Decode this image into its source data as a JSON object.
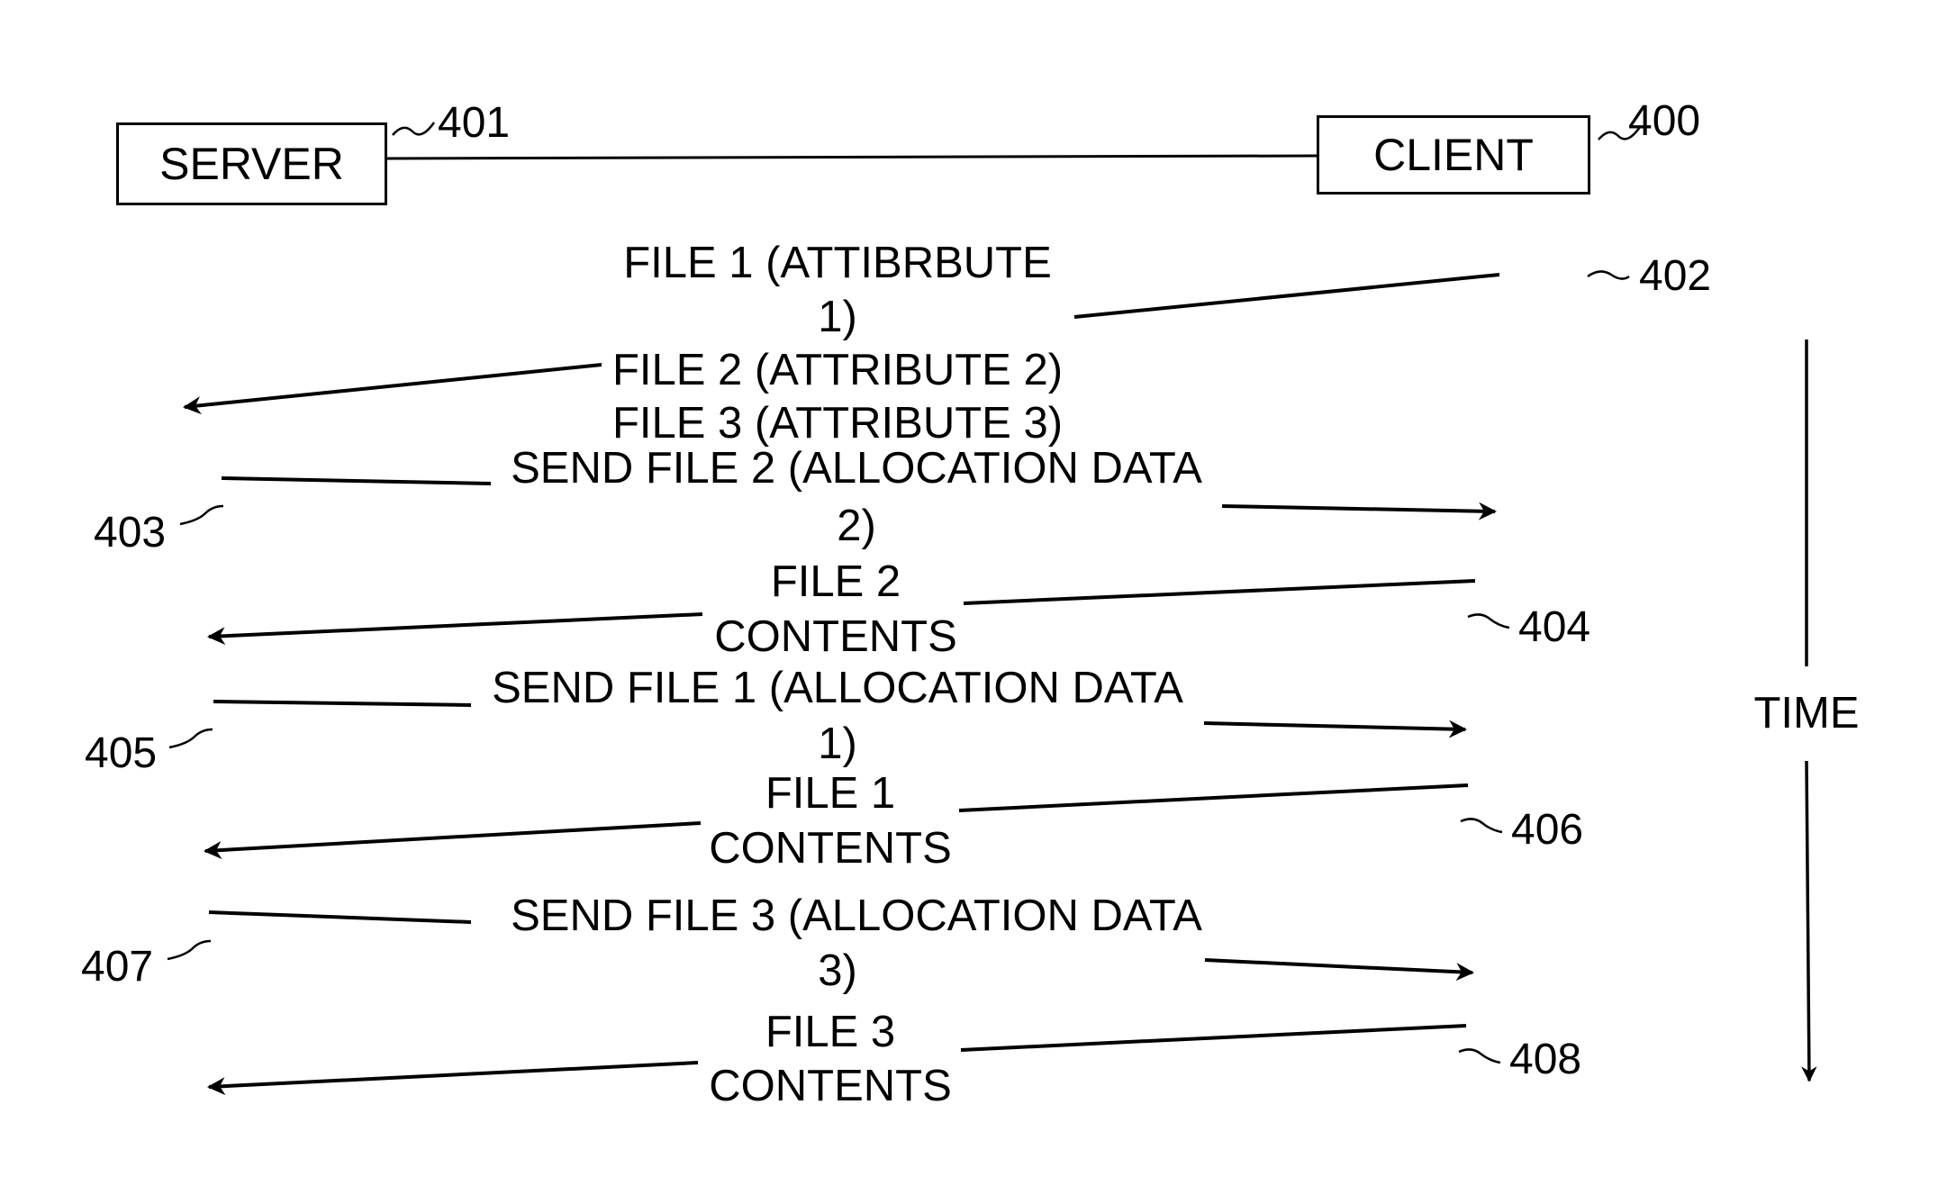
{
  "figure": {
    "entities": {
      "server": {
        "label": "SERVER",
        "ref": "401"
      },
      "client": {
        "label": "CLIENT",
        "ref": "400"
      }
    },
    "time_axis": {
      "label": "TIME",
      "direction": "down"
    },
    "messages": [
      {
        "ref": "402",
        "from": "client",
        "to": "server",
        "lines": [
          "FILE 1 (ATTIBRBUTE",
          "1)",
          "FILE 2 (ATTRIBUTE 2)",
          "FILE 3 (ATTRIBUTE 3)"
        ]
      },
      {
        "ref": "403",
        "from": "server",
        "to": "client",
        "lines": [
          "SEND FILE 2 (ALLOCATION DATA",
          "2)"
        ]
      },
      {
        "ref": "404",
        "from": "client",
        "to": "server",
        "lines": [
          "FILE 2",
          "CONTENTS"
        ]
      },
      {
        "ref": "405",
        "from": "server",
        "to": "client",
        "lines": [
          "SEND FILE 1 (ALLOCATION DATA",
          "1)"
        ]
      },
      {
        "ref": "406",
        "from": "client",
        "to": "server",
        "lines": [
          "FILE 1",
          "CONTENTS"
        ]
      },
      {
        "ref": "407",
        "from": "server",
        "to": "client",
        "lines": [
          "SEND FILE 3 (ALLOCATION DATA",
          "3)"
        ]
      },
      {
        "ref": "408",
        "from": "client",
        "to": "server",
        "lines": [
          "FILE 3",
          "CONTENTS"
        ]
      }
    ]
  }
}
